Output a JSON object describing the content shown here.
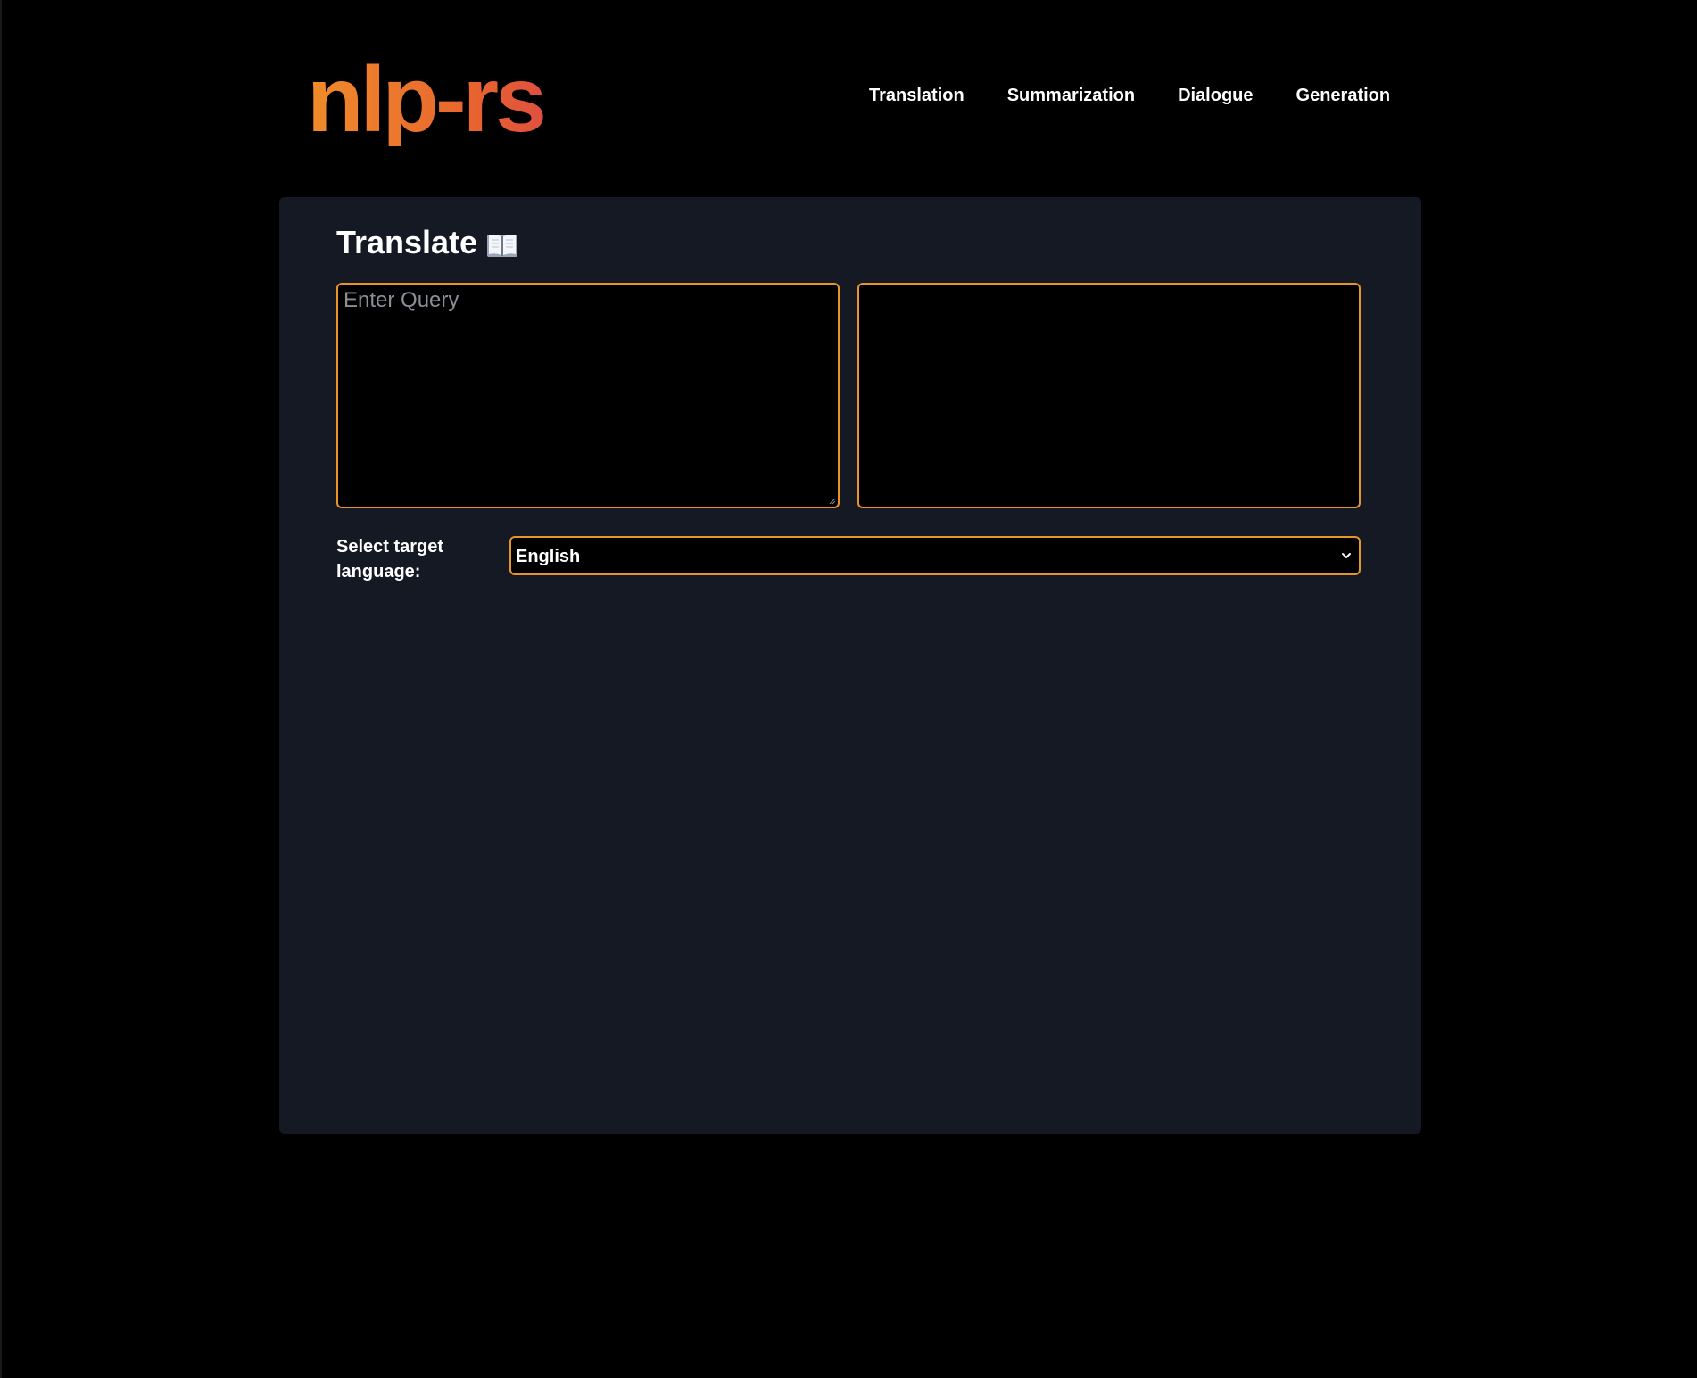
{
  "header": {
    "logo_text": "nlp-rs",
    "nav": [
      {
        "label": "Translation"
      },
      {
        "label": "Summarization"
      },
      {
        "label": "Dialogue"
      },
      {
        "label": "Generation"
      }
    ]
  },
  "translate": {
    "title": "Translate",
    "title_icon": "open-book-icon",
    "query_placeholder": "Enter Query",
    "query_value": "",
    "output_value": "",
    "language_label": "Select target language:",
    "language_selected": "English"
  },
  "colors": {
    "background": "#000000",
    "panel": "#141923",
    "accent_border": "#e8942c",
    "logo_gradient_start": "#ef8c2a",
    "logo_gradient_end": "#e0503f"
  }
}
